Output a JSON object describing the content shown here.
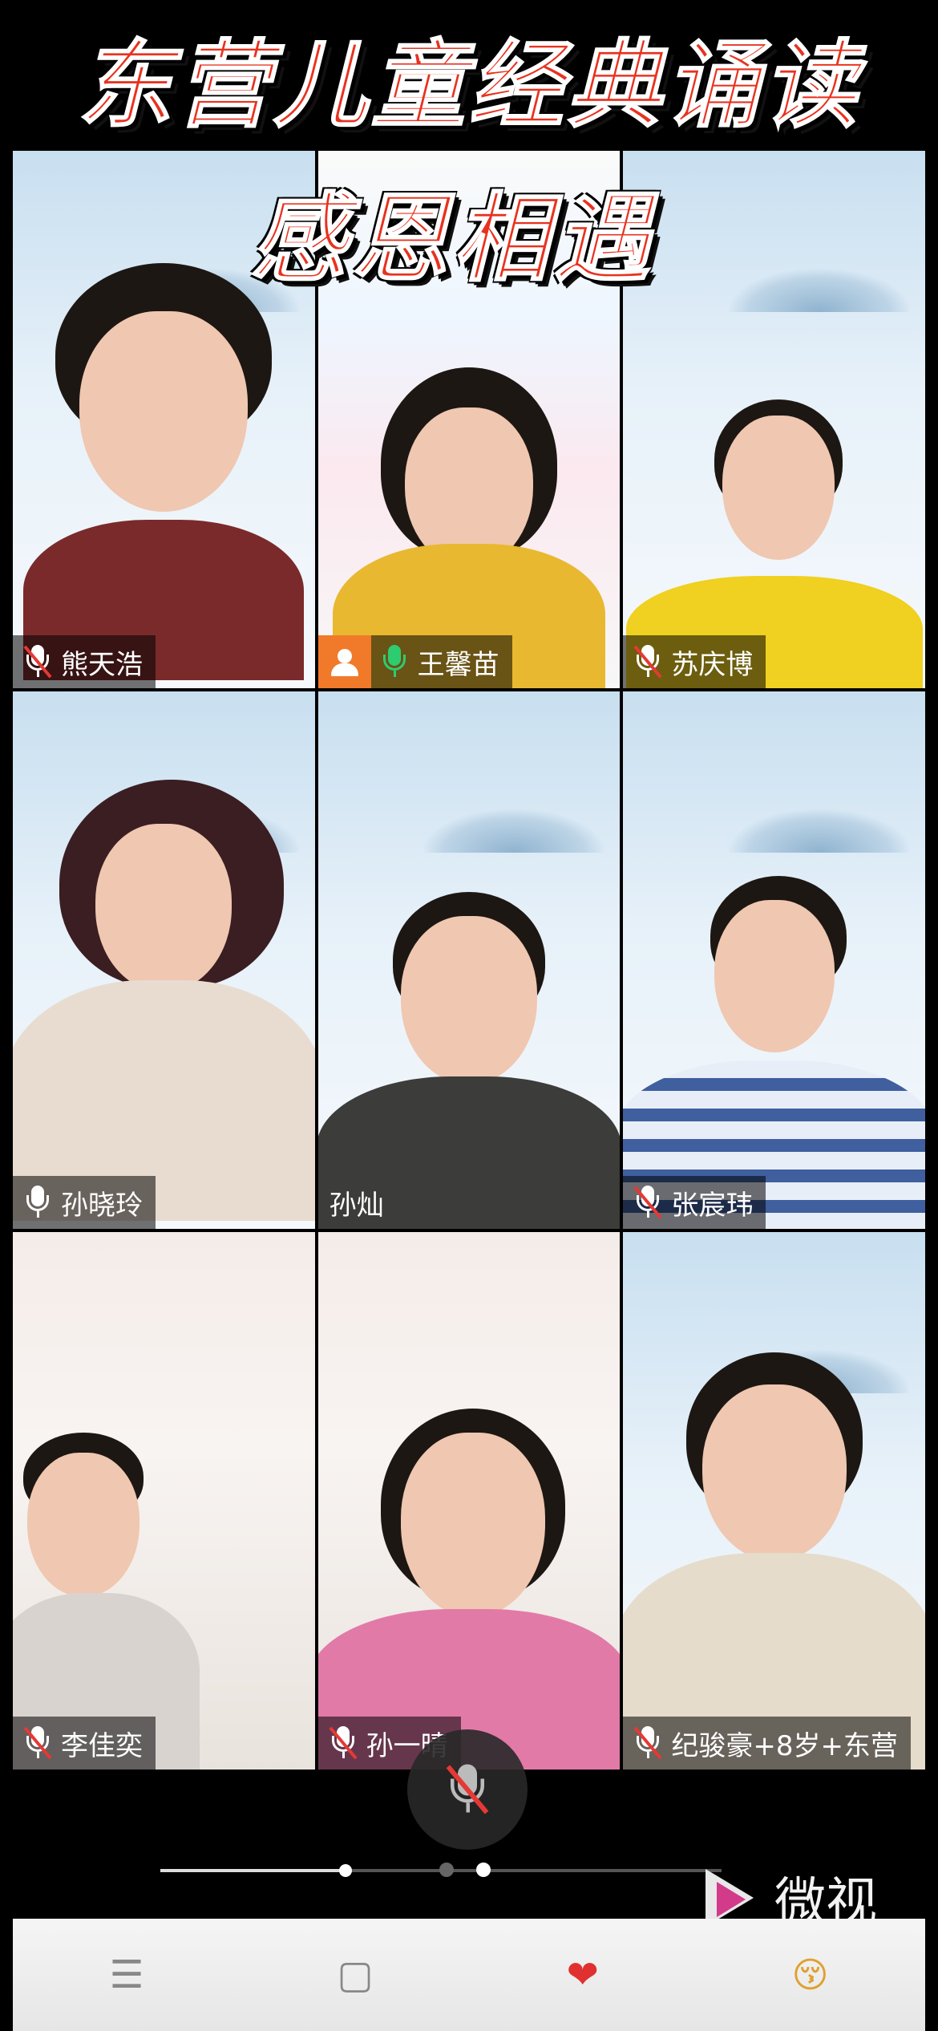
{
  "title": {
    "line1": "东营儿童经典诵读",
    "line2": "感恩相遇"
  },
  "participants": [
    {
      "name": "熊天浩",
      "mic": "muted",
      "host": false
    },
    {
      "name": "王馨苗",
      "mic": "on",
      "host": true
    },
    {
      "name": "苏庆博",
      "mic": "muted",
      "host": false
    },
    {
      "name": "孙晓玲",
      "mic": "on-white",
      "host": false
    },
    {
      "name": "孙灿",
      "mic": "none",
      "host": false
    },
    {
      "name": "张宸玮",
      "mic": "muted",
      "host": false
    },
    {
      "name": "李佳奕",
      "mic": "muted",
      "host": false
    },
    {
      "name": "孙一晴",
      "mic": "muted",
      "host": false
    },
    {
      "name": "纪骏豪+8岁+东营",
      "mic": "muted",
      "host": false
    }
  ],
  "controls": {
    "center_mic_icon": "mic-muted-icon",
    "progress_fraction": 0.33,
    "page_count": 2,
    "current_page": 2
  },
  "watermark": {
    "text": "微视",
    "icon": "weishi-logo"
  },
  "navbar": {
    "icons": [
      "menu-icon",
      "home-square-icon",
      "heart-icon",
      "emoji-icon"
    ],
    "glyphs": [
      "☰",
      "▢",
      "❤",
      "😚"
    ]
  },
  "colors": {
    "title_red": "#e8321f",
    "active_border": "#2aa84a",
    "muted_slash": "#e53935",
    "host_badge": "#f07a2a"
  }
}
